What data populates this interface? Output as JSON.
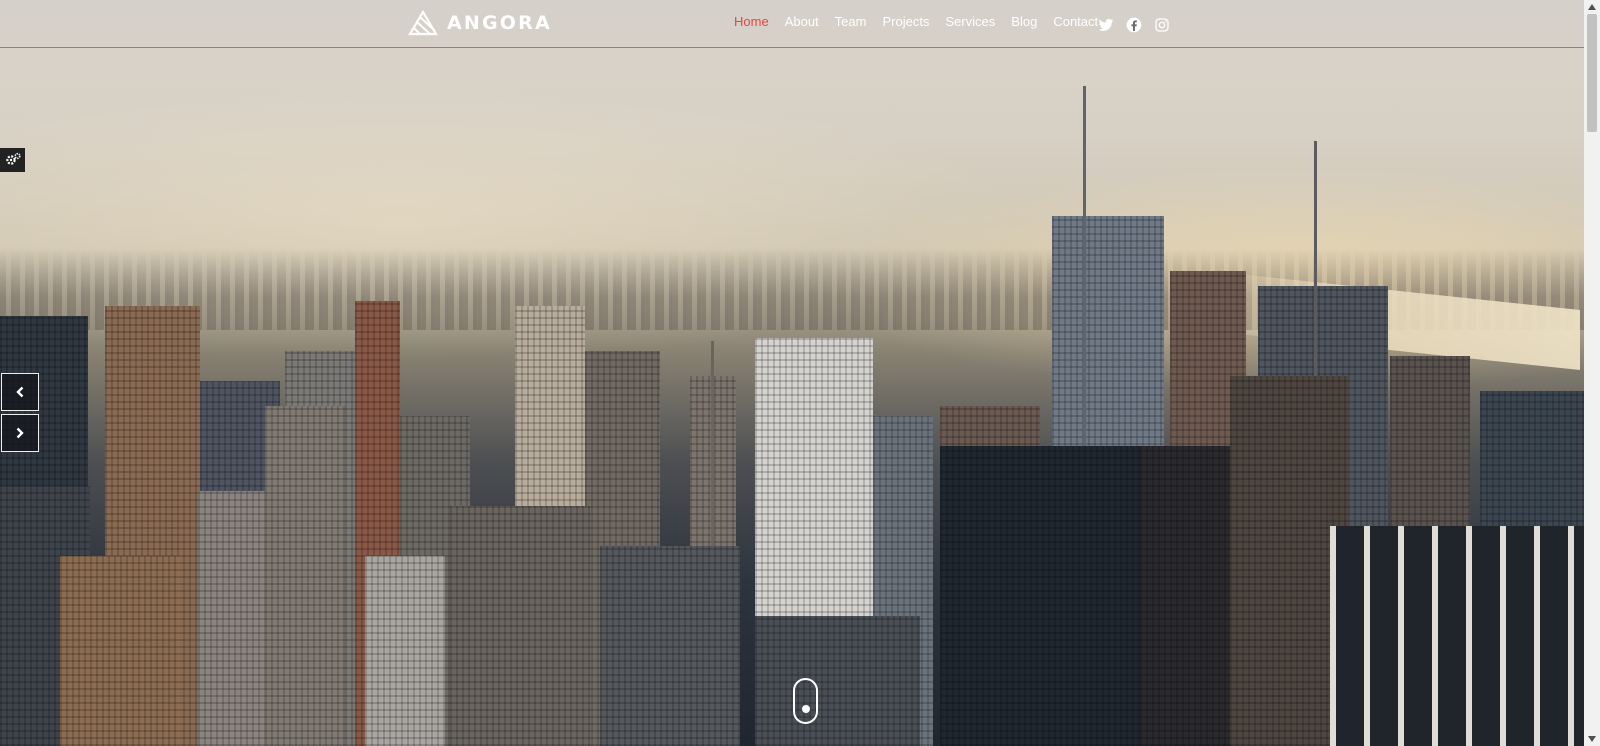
{
  "brand": {
    "name": "ANGORA",
    "logo_icon": "angora-logo-icon"
  },
  "nav": {
    "items": [
      {
        "label": "Home",
        "active": true
      },
      {
        "label": "About",
        "active": false
      },
      {
        "label": "Team",
        "active": false
      },
      {
        "label": "Projects",
        "active": false
      },
      {
        "label": "Services",
        "active": false
      },
      {
        "label": "Blog",
        "active": false
      },
      {
        "label": "Contact",
        "active": false
      }
    ],
    "active_color": "#e7473c",
    "social": [
      "twitter-icon",
      "facebook-icon",
      "instagram-icon"
    ]
  },
  "hero": {
    "background": "city-skyline-photo",
    "prev_icon": "chevron-left-icon",
    "next_icon": "chevron-right-icon",
    "scroll_indicator": "mouse-scroll-icon"
  },
  "settings": {
    "icon": "gears-icon"
  }
}
